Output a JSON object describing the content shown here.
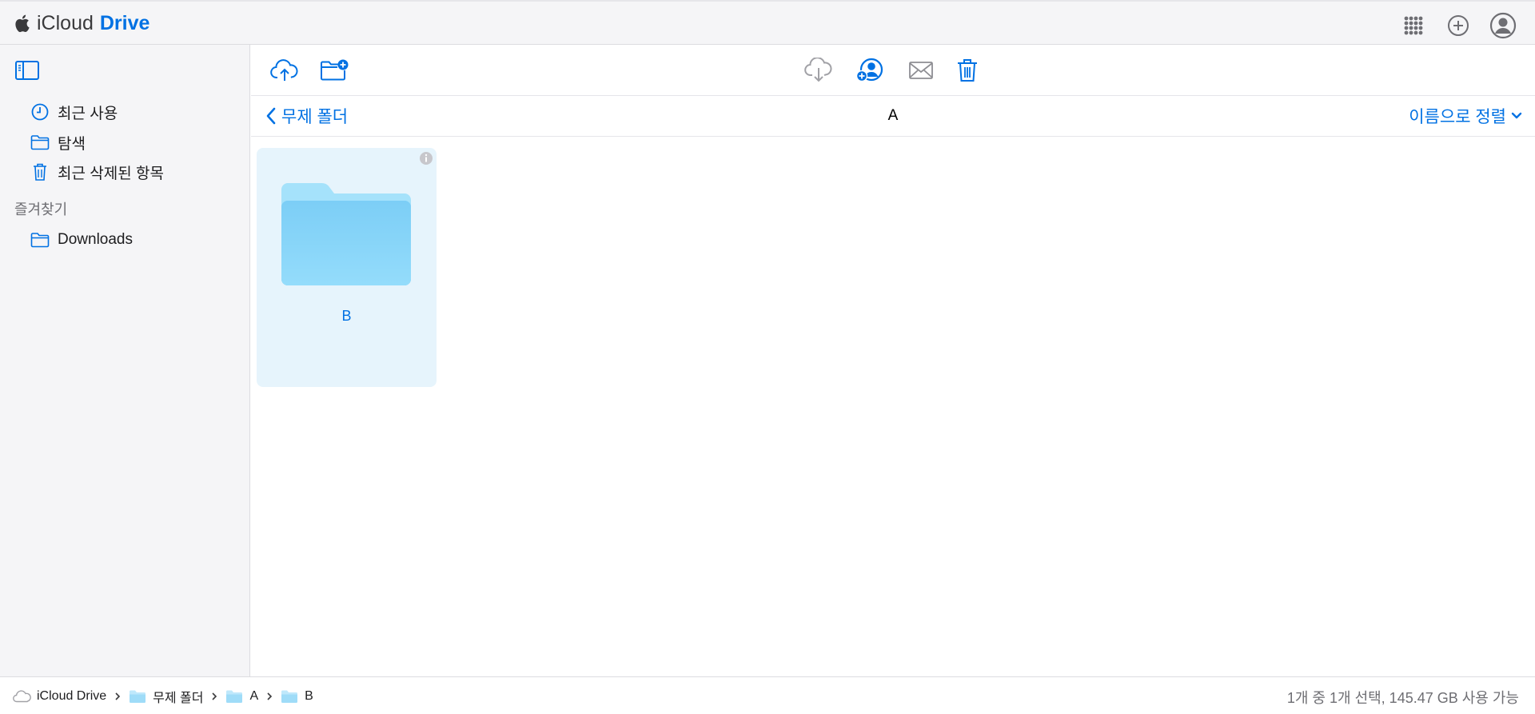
{
  "app": {
    "name_part1": "iCloud",
    "name_part2": "Drive"
  },
  "top_icons": [
    "app-grid-icon",
    "plus-circle-icon",
    "account-icon"
  ],
  "sidebar": {
    "toggle_icon": "sidebar-toggle-icon",
    "items": [
      {
        "label": "최근 사용",
        "icon": "clock-icon"
      },
      {
        "label": "탐색",
        "icon": "folder-icon"
      },
      {
        "label": "최근 삭제된 항목",
        "icon": "trash-icon"
      }
    ],
    "favorites_heading": "즐겨찾기",
    "favorites": [
      {
        "label": "Downloads",
        "icon": "folder-icon"
      }
    ]
  },
  "toolbar": {
    "left": [
      "upload-icon",
      "new-folder-icon"
    ],
    "center": [
      "download-icon",
      "share-collaborate-icon",
      "email-icon",
      "delete-icon"
    ]
  },
  "nav": {
    "back_label": "무제 폴더",
    "current_folder": "A",
    "sort_label": "이름으로 정렬"
  },
  "items": [
    {
      "name": "B",
      "type": "folder",
      "selected": true
    }
  ],
  "status": {
    "breadcrumb": [
      "iCloud Drive",
      "무제 폴더",
      "A",
      "B"
    ],
    "summary": "1개 중 1개 선택, 145.47 GB 사용 가능"
  },
  "colors": {
    "accent": "#0071e3",
    "sidebar_bg": "#f5f5f7",
    "selected_tile": "#e6f4fc",
    "folder_light": "#a5e2fb",
    "folder_dark": "#7dcff6"
  }
}
